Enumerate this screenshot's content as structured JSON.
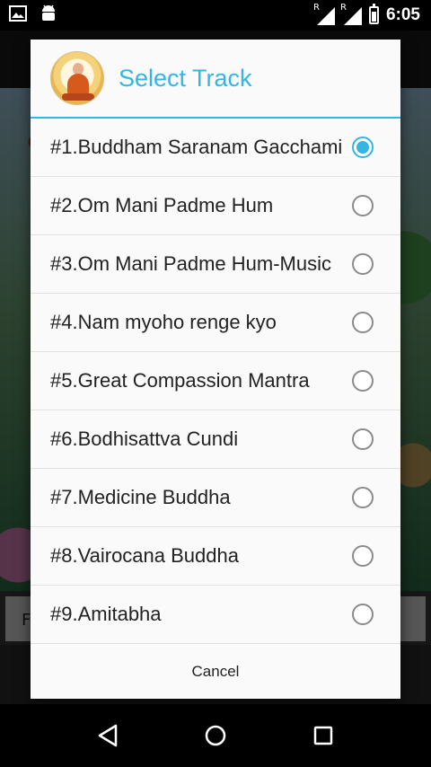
{
  "status_bar": {
    "time": "6:05",
    "signal_label_1": "R",
    "signal_label_2": "R",
    "icons": [
      "image-icon",
      "android-icon",
      "signal-icon",
      "signal-icon",
      "battery-icon"
    ]
  },
  "dialog": {
    "title": "Select Track",
    "selected_index": 0,
    "tracks": [
      {
        "label": "#1.Buddham Saranam Gacchami",
        "checked": true
      },
      {
        "label": "#2.Om Mani Padme Hum",
        "checked": false
      },
      {
        "label": "#3.Om Mani Padme Hum-Music",
        "checked": false
      },
      {
        "label": "#4.Nam myoho renge kyo",
        "checked": false
      },
      {
        "label": "#5.Great Compassion Mantra",
        "checked": false
      },
      {
        "label": "#6.Bodhisattva Cundi",
        "checked": false
      },
      {
        "label": "#7.Medicine Buddha",
        "checked": false
      },
      {
        "label": "#8.Vairocana Buddha",
        "checked": false
      },
      {
        "label": "#9.Amitabha",
        "checked": false
      }
    ],
    "cancel_label": "Cancel"
  },
  "background": {
    "left_button_label": "F"
  },
  "colors": {
    "accent": "#33b5e5",
    "text": "#222222"
  }
}
